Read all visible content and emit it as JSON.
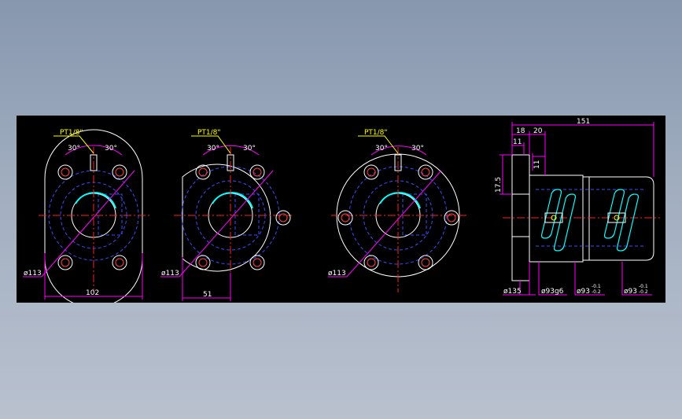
{
  "colors": {
    "background": "#000000",
    "outline": "#ffffff",
    "center_line": "#ff2020",
    "hidden_line": "#3a4cff",
    "dimension": "#ff00ff",
    "text": "#ffffff",
    "leader": "#ffff00",
    "highlight": "#00ffff",
    "hole": "#ff4040",
    "accent": "#00ff00"
  },
  "views": [
    {
      "label_port": "PT1/8\"",
      "label_angle_left": "30°",
      "label_angle_right": "30°",
      "label_diameter": "ø113",
      "label_width": "102"
    },
    {
      "label_port": "PT1/8\"",
      "label_angle_left": "30°",
      "label_angle_right": "30°",
      "label_diameter": "ø113",
      "label_width": "51"
    },
    {
      "label_port": "PT1/8\"",
      "label_angle_left": "30°",
      "label_angle_right": "30°",
      "label_diameter": "ø113"
    }
  ],
  "side_view": {
    "label_length": "151",
    "label_18": "18",
    "label_20": "20",
    "label_11a": "11",
    "label_11b": "11",
    "label_17_5": "17.5",
    "label_d135": "ø135",
    "label_d93g6": "ø93g6",
    "label_d93_a": "ø93",
    "label_d93_b": "ø93",
    "tol_a_upper": "-0.1",
    "tol_a_lower": "-0.2",
    "tol_b_upper": "-0.1",
    "tol_b_lower": "-0.2"
  }
}
